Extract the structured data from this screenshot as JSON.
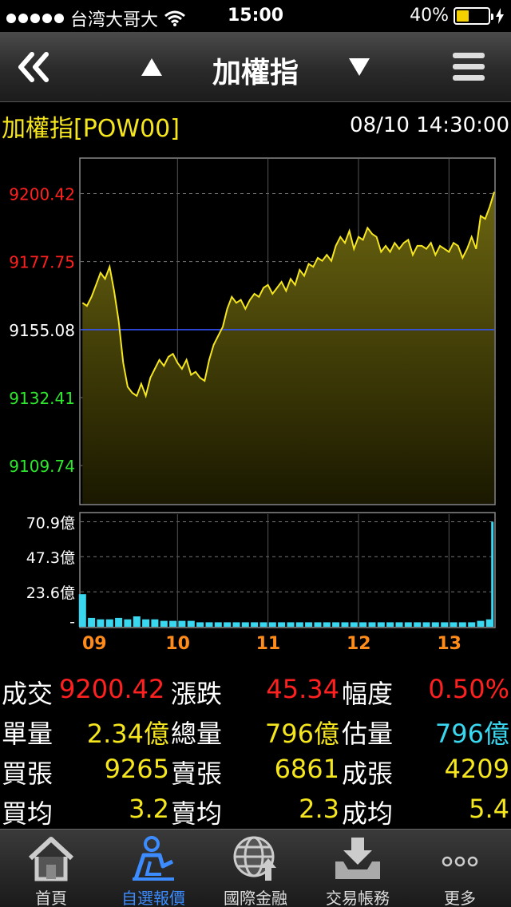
{
  "status_bar": {
    "carrier": "台湾大哥大",
    "time": "15:00",
    "battery": "40%",
    "battery_level": 0.4
  },
  "nav": {
    "title": "加權指",
    "icons": [
      "back-double-chevron-icon",
      "up-triangle-icon",
      "down-triangle-icon",
      "menu-icon"
    ]
  },
  "info": {
    "symbol": "加權指[POW00]",
    "timestamp": "08/10 14:30:00"
  },
  "colors": {
    "accent_yellow": "#f5e61e",
    "up_red": "#ff2020",
    "down_green": "#2ee82e",
    "cyan": "#3ad7f0",
    "orange": "#ff8c1a",
    "tab_active": "#3c8cff"
  },
  "chart_data": [
    {
      "type": "area",
      "y_tick_labels": [
        "9200.42",
        "9177.75",
        "9155.08",
        "9132.41",
        "9109.74"
      ],
      "y_ticks": [
        9200.42,
        9177.75,
        9155.08,
        9132.41,
        9109.74
      ],
      "reference_line": 9155.08,
      "ylim": [
        9097,
        9212
      ],
      "x_tick_labels": [
        "09",
        "10",
        "11",
        "12",
        "13"
      ],
      "x_hours": [
        9,
        10,
        11,
        12,
        13
      ],
      "xlim": [
        8.93,
        13.5
      ],
      "series": [
        {
          "x": [
            8.95,
            9.0,
            9.05,
            9.1,
            9.15,
            9.2,
            9.25,
            9.3,
            9.35,
            9.4,
            9.45,
            9.5,
            9.55,
            9.6,
            9.65,
            9.7,
            9.75,
            9.8,
            9.85,
            9.9,
            9.95,
            10.0,
            10.05,
            10.1,
            10.15,
            10.2,
            10.25,
            10.3,
            10.35,
            10.4,
            10.45,
            10.5,
            10.55,
            10.6,
            10.65,
            10.7,
            10.75,
            10.8,
            10.85,
            10.9,
            10.95,
            11.0,
            11.05,
            11.1,
            11.15,
            11.2,
            11.25,
            11.3,
            11.35,
            11.4,
            11.45,
            11.5,
            11.55,
            11.6,
            11.65,
            11.7,
            11.75,
            11.8,
            11.85,
            11.9,
            11.95,
            12.0,
            12.05,
            12.1,
            12.15,
            12.2,
            12.25,
            12.3,
            12.35,
            12.4,
            12.45,
            12.5,
            12.55,
            12.6,
            12.65,
            12.7,
            12.75,
            12.8,
            12.85,
            12.9,
            12.95,
            13.0,
            13.05,
            13.1,
            13.15,
            13.2,
            13.25,
            13.3,
            13.35,
            13.4,
            13.45,
            13.5
          ],
          "values": [
            9164,
            9163,
            9166,
            9170,
            9174,
            9172,
            9176,
            9168,
            9158,
            9144,
            9136,
            9134,
            9133,
            9137,
            9133,
            9139,
            9142,
            9145,
            9143,
            9146,
            9147,
            9144,
            9142,
            9145,
            9140,
            9141,
            9139,
            9138,
            9145,
            9150,
            9153,
            9156,
            9162,
            9166,
            9164,
            9165,
            9162,
            9165,
            9167,
            9166,
            9169,
            9170,
            9167,
            9169,
            9171,
            9168,
            9172,
            9170,
            9175,
            9173,
            9177,
            9176,
            9179,
            9178,
            9180,
            9178,
            9183,
            9186,
            9184,
            9188,
            9182,
            9186,
            9185,
            9189,
            9187,
            9186,
            9181,
            9183,
            9181,
            9184,
            9182,
            9184,
            9185,
            9180,
            9183,
            9183,
            9182,
            9184,
            9180,
            9183,
            9182,
            9181,
            9184,
            9183,
            9179,
            9182,
            9186,
            9182,
            9193,
            9192,
            9196,
            9201
          ]
        }
      ]
    },
    {
      "type": "bar",
      "y_tick_labels": [
        "70.9億",
        "47.3億",
        "23.6億",
        "-"
      ],
      "y_ticks": [
        70.9,
        47.3,
        23.6,
        0
      ],
      "ylim": [
        0,
        76
      ],
      "x_tick_labels": [
        "09",
        "10",
        "11",
        "12",
        "13"
      ],
      "xlim": [
        8.93,
        13.5
      ],
      "series": [
        {
          "x": [
            8.95,
            9.05,
            9.15,
            9.25,
            9.35,
            9.45,
            9.55,
            9.65,
            9.75,
            9.85,
            9.95,
            10.05,
            10.15,
            10.25,
            10.35,
            10.45,
            10.55,
            10.65,
            10.75,
            10.85,
            10.95,
            11.05,
            11.15,
            11.25,
            11.35,
            11.45,
            11.55,
            11.65,
            11.75,
            11.85,
            11.95,
            12.05,
            12.15,
            12.25,
            12.35,
            12.45,
            12.55,
            12.65,
            12.75,
            12.85,
            12.95,
            13.05,
            13.15,
            13.25,
            13.35,
            13.45,
            13.48
          ],
          "values": [
            22,
            6,
            5,
            5,
            6,
            5,
            7,
            5,
            5,
            4,
            4,
            4,
            4,
            3,
            3,
            3,
            3,
            3,
            3,
            3,
            3,
            3,
            3,
            3,
            3,
            3,
            3,
            3,
            3,
            3,
            3,
            3,
            3,
            3,
            3,
            3,
            3,
            3,
            3,
            3,
            3,
            3,
            3,
            3,
            4,
            5,
            70.9
          ]
        }
      ]
    }
  ],
  "stats": [
    {
      "label": "成交",
      "value": "9200.42",
      "label2": "漲跌",
      "value2": "45.34",
      "label3": "幅度",
      "value3": "0.50%"
    },
    {
      "label": "單量",
      "value": "2.34億",
      "label2": "總量",
      "value2": "796億",
      "label3": "估量",
      "value3": "796億"
    },
    {
      "label": "買張",
      "value": "9265",
      "label2": "賣張",
      "value2": "6861",
      "label3": "成張",
      "value3": "4209"
    },
    {
      "label": "買均",
      "value": "3.2",
      "label2": "賣均",
      "value2": "2.3",
      "label3": "成均",
      "value3": "5.4"
    }
  ],
  "tabs": [
    {
      "label": "首頁",
      "icon": "home-icon"
    },
    {
      "label": "自選報價",
      "icon": "watchlist-person-icon",
      "active": true
    },
    {
      "label": "國際金融",
      "icon": "globe-icon"
    },
    {
      "label": "交易帳務",
      "icon": "inbox-download-icon"
    },
    {
      "label": "更多",
      "icon": "more-dots-icon"
    }
  ]
}
